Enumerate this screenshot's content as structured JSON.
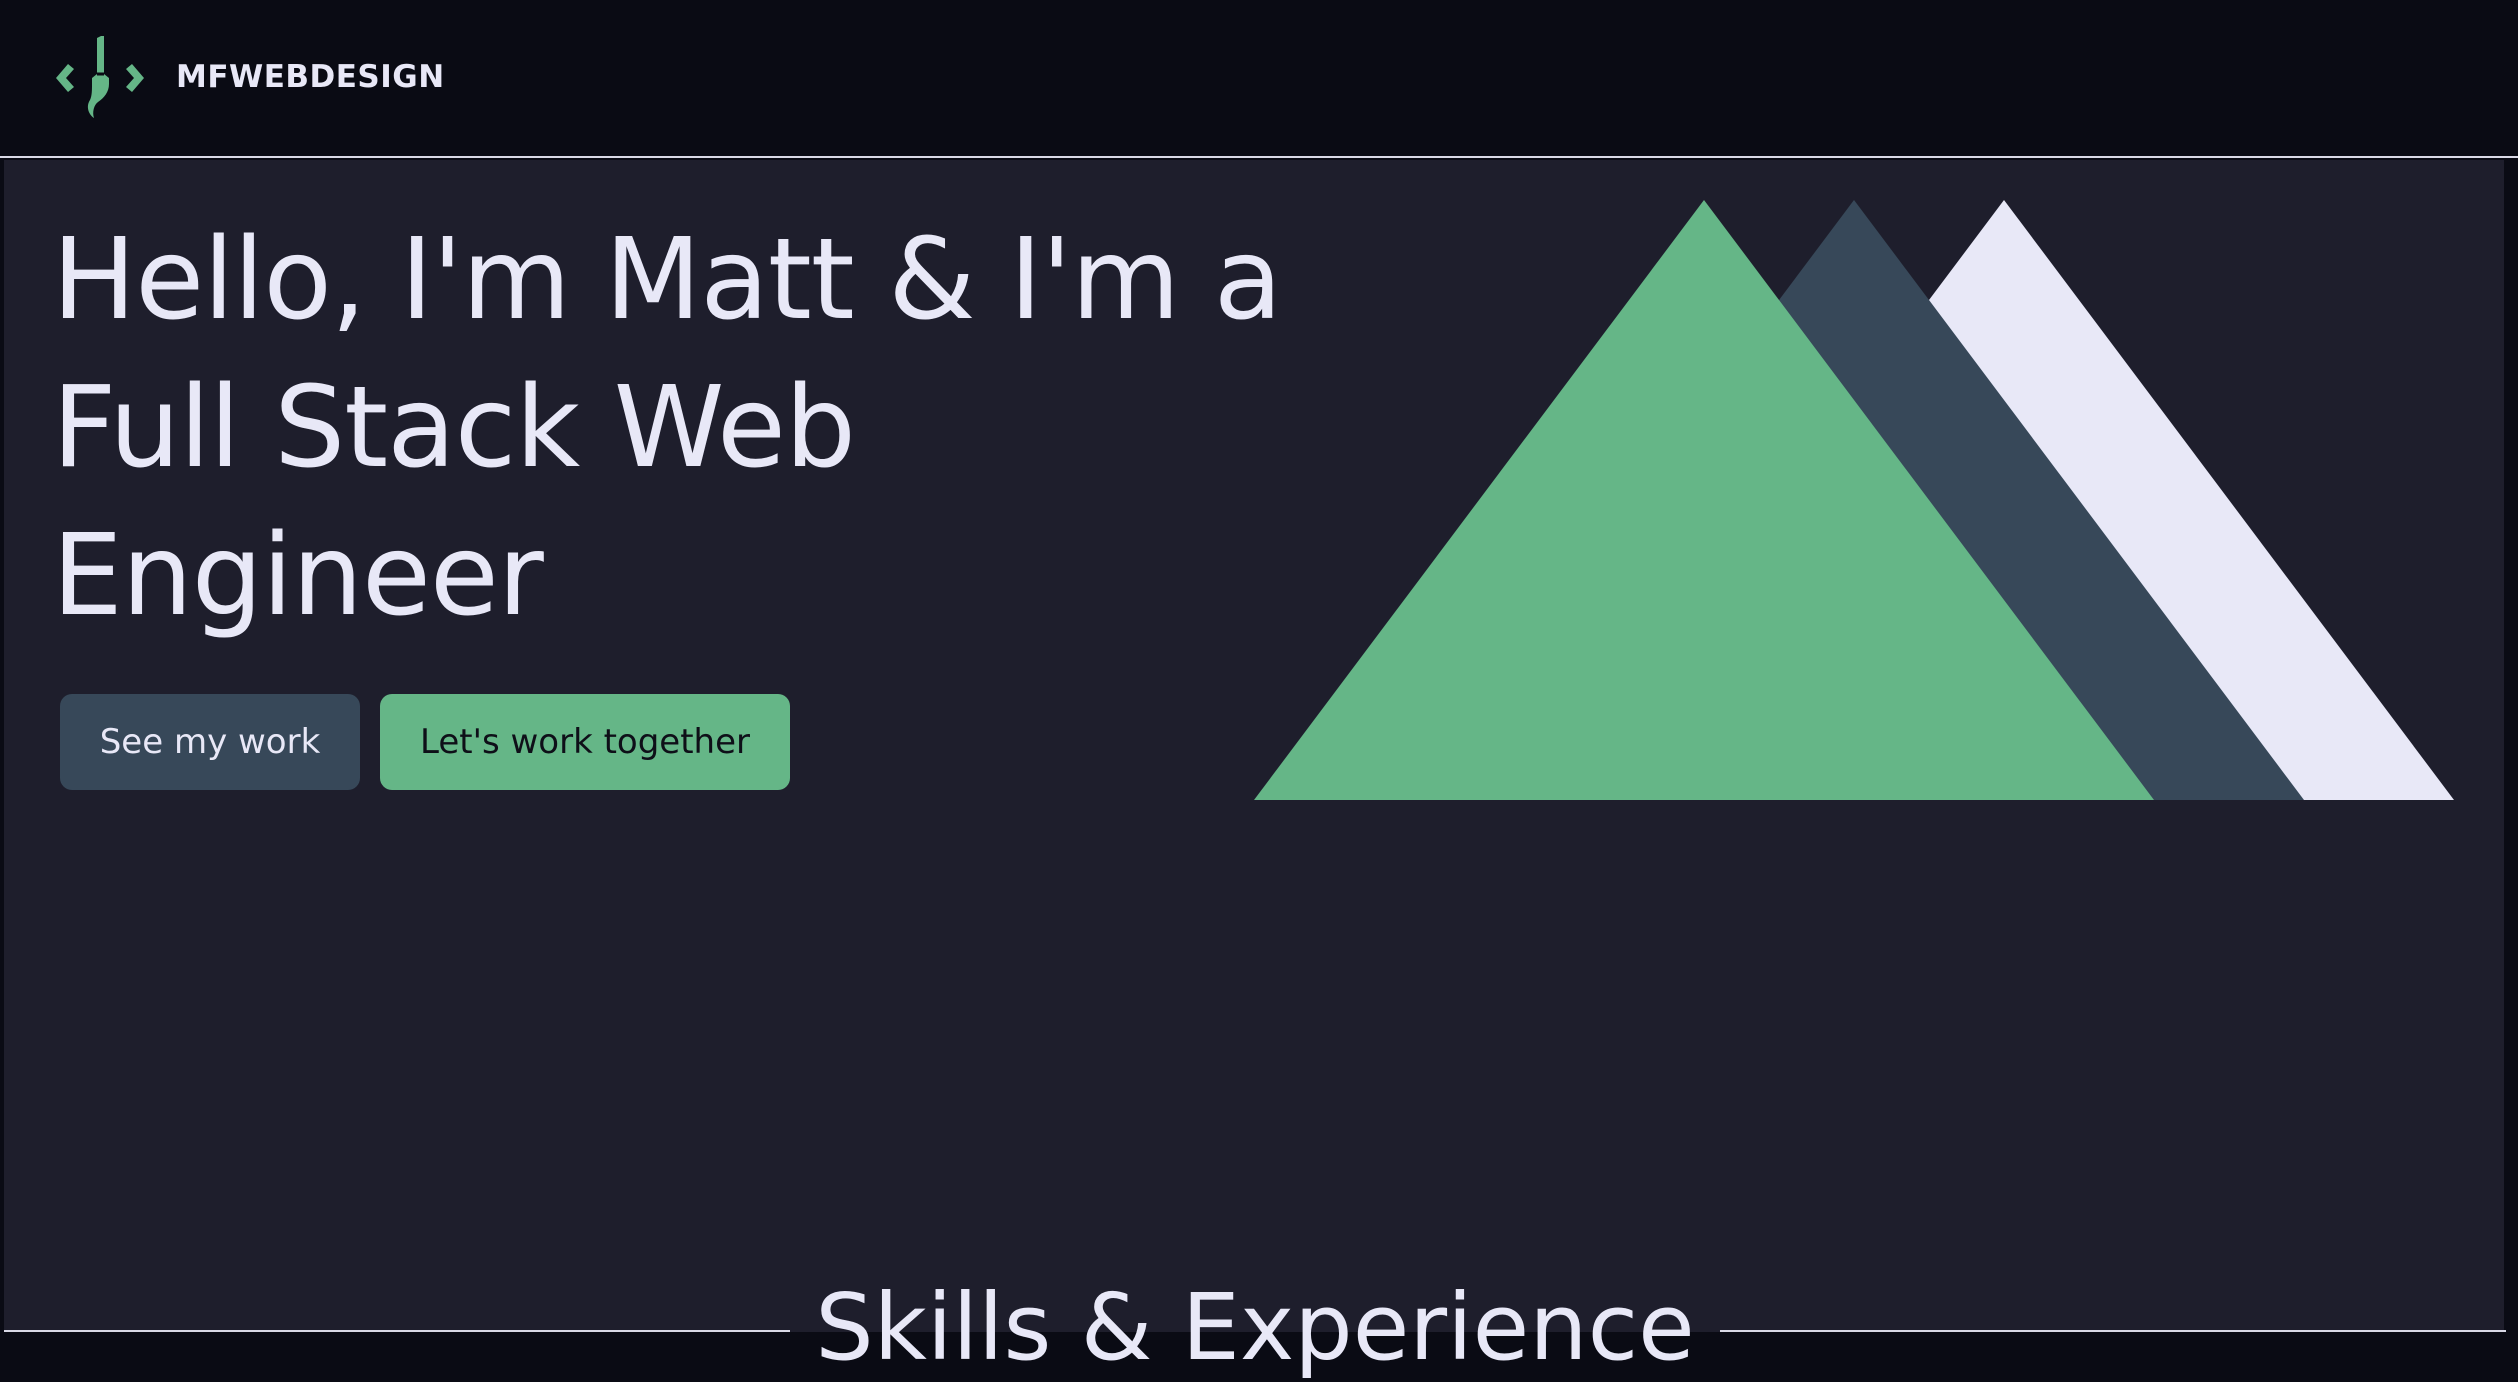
{
  "header": {
    "brand": "MFWEBDESIGN",
    "logo_icon": "code-brackets-paintbrush-icon"
  },
  "hero": {
    "title": "Hello, I'm Matt & I'm a Full Stack Web Engineer",
    "secondary_button": "See my work",
    "primary_button": "Let's work together",
    "illustration": "mountains-illustration"
  },
  "skills_section": {
    "title": "Skills & Experience"
  },
  "colors": {
    "background_dark": "#0a0b14",
    "hero_background": "#1e1e2c",
    "accent_green": "#65b687",
    "slate": "#374859",
    "light": "#e8e8f7"
  }
}
